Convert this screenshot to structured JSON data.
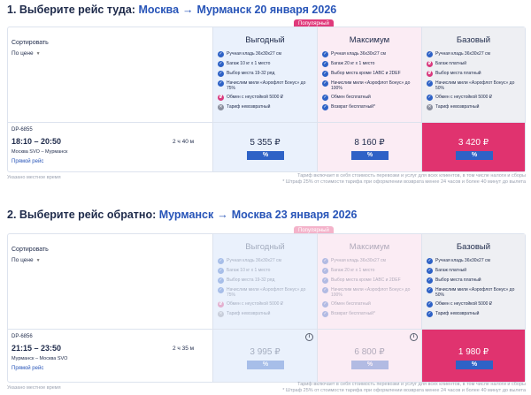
{
  "outbound": {
    "title_prefix": "1. Выберите рейс туда:",
    "from": "Москва",
    "arrow": "→",
    "to": "Мурманск",
    "date": "20 января 2026",
    "popular_badge": "Популярный",
    "sort_label": "Сортировать",
    "sort_value": "По цене",
    "tariffs": [
      {
        "name": "Выгодный",
        "features": [
          {
            "icon": "check",
            "text": "Ручная кладь 36x30x27 см"
          },
          {
            "icon": "check",
            "text": "Багаж 10 кг х 1 место"
          },
          {
            "icon": "check",
            "text": "Выбор места 19-32 ряд"
          },
          {
            "icon": "check",
            "text": "Начислим мили «Аэрофлот Бонус» до 75%"
          },
          {
            "icon": "pay",
            "text": "Обмен с неустойкой 5000 ₽"
          },
          {
            "icon": "cross",
            "text": "Тариф невозвратный"
          }
        ]
      },
      {
        "name": "Максимум",
        "features": [
          {
            "icon": "check",
            "text": "Ручная кладь 36x30x27 см"
          },
          {
            "icon": "check",
            "text": "Багаж 20 кг х 1 место"
          },
          {
            "icon": "check",
            "text": "Выбор места кроме 1ABC и 2DEF"
          },
          {
            "icon": "check",
            "text": "Начислим мили «Аэрофлот Бонус» до 100%"
          },
          {
            "icon": "check",
            "text": "Обмен бесплатный"
          },
          {
            "icon": "check",
            "text": "Возврат бесплатный*"
          }
        ]
      },
      {
        "name": "Базовый",
        "features": [
          {
            "icon": "check",
            "text": "Ручная кладь 36x30x27 см"
          },
          {
            "icon": "pay",
            "text": "Багаж платный"
          },
          {
            "icon": "pay",
            "text": "Выбор места платный"
          },
          {
            "icon": "check",
            "text": "Начислим мили «Аэрофлот Бонус» до 50%"
          },
          {
            "icon": "check",
            "text": "Обмен с неустойкой 5000 ₽"
          },
          {
            "icon": "cross",
            "text": "Тариф невозвратный"
          }
        ]
      }
    ],
    "flight": {
      "code": "DP-6855",
      "time": "18:10 – 20:50",
      "duration": "2 ч 40 м",
      "airports": "Москва SVO – Мурманск",
      "type": "Прямой рейс"
    },
    "prices": [
      "5 355 ₽",
      "8 160 ₽",
      "3 420 ₽"
    ],
    "discount": "%",
    "local_time": "Указано местное время",
    "note_line1": "Тариф включает в себя стоимость перевозки и услуг для всех клиентов, в том числе налоги и сборы",
    "note_line2": "* Штраф 25% от стоимости тарифа при оформлении возврата менее 24 часов и более 40 минут до вылета"
  },
  "return": {
    "title_prefix": "2. Выберите рейс обратно:",
    "from": "Мурманск",
    "arrow": "→",
    "to": "Москва",
    "date": "23 января 2026",
    "popular_badge": "Популярный",
    "sort_label": "Сортировать",
    "sort_value": "По цене",
    "tariffs": [
      {
        "name": "Выгодный",
        "features": [
          {
            "icon": "check",
            "text": "Ручная кладь 36x30x27 см"
          },
          {
            "icon": "check",
            "text": "Багаж 10 кг х 1 место"
          },
          {
            "icon": "check",
            "text": "Выбор места 19-32 ряд"
          },
          {
            "icon": "check",
            "text": "Начислим мили «Аэрофлот Бонус» до 75%"
          },
          {
            "icon": "pay",
            "text": "Обмен с неустойкой 5000 ₽"
          },
          {
            "icon": "cross",
            "text": "Тариф невозвратный"
          }
        ]
      },
      {
        "name": "Максимум",
        "features": [
          {
            "icon": "check",
            "text": "Ручная кладь 36x30x27 см"
          },
          {
            "icon": "check",
            "text": "Багаж 20 кг х 1 место"
          },
          {
            "icon": "check",
            "text": "Выбор места кроме 1ABC и 2DEF"
          },
          {
            "icon": "check",
            "text": "Начислим мили «Аэрофлот Бонус» до 100%"
          },
          {
            "icon": "check",
            "text": "Обмен бесплатный"
          },
          {
            "icon": "check",
            "text": "Возврат бесплатный*"
          }
        ]
      },
      {
        "name": "Базовый",
        "features": [
          {
            "icon": "check",
            "text": "Ручная кладь 36x30x27 см"
          },
          {
            "icon": "check",
            "text": "Багаж платный"
          },
          {
            "icon": "check",
            "text": "Выбор места платный"
          },
          {
            "icon": "check",
            "text": "Начислим мили «Аэрофлот Бонус» до 50%"
          },
          {
            "icon": "check",
            "text": "Обмен с неустойкой 5000 ₽"
          },
          {
            "icon": "check",
            "text": "Тариф невозвратный"
          }
        ]
      }
    ],
    "flight": {
      "code": "DP-6856",
      "time": "21:15 – 23:50",
      "duration": "2 ч 35 м",
      "airports": "Мурманск – Москва SVO",
      "type": "Прямой рейс"
    },
    "prices": [
      "3 995 ₽",
      "6 800 ₽",
      "1 980 ₽"
    ],
    "discount": "%",
    "info_glyph": "i",
    "local_time": "Указано местное время",
    "note_line1": "Тариф включает в себя стоимость перевозки и услуг для всех клиентов, в том числе налоги и сборы",
    "note_line2": "* Штраф 25% от стоимости тарифа при оформлении возврата менее 24 часов и более 40 минут до вылета"
  },
  "icons": {
    "check": "✓",
    "pay": "₽",
    "cross": "✕",
    "chevron": "▼"
  },
  "colors": {
    "accent": "#2754b8",
    "selected": "#e0336f",
    "discount": "#2e62c6"
  }
}
